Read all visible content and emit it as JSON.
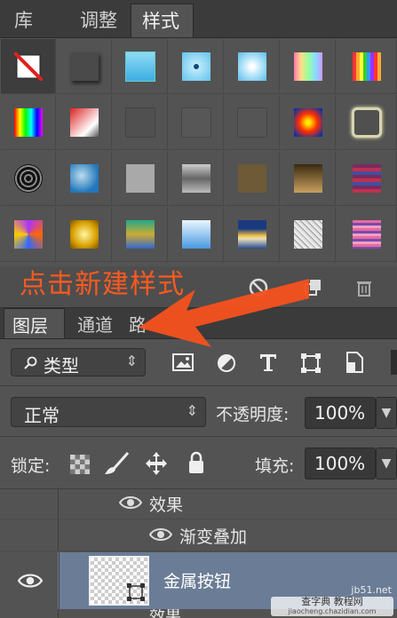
{
  "tabs": {
    "library": "库",
    "adjust": "调整",
    "styles": "样式"
  },
  "annotation": "点击新建样式",
  "layers_tabs": {
    "layers": "图层",
    "channels": "通道",
    "paths": "路"
  },
  "filter": {
    "kind_label": "类型",
    "arrows": "⇕"
  },
  "blend": {
    "mode": "正常",
    "opacity_label": "不透明度:",
    "opacity": "100%"
  },
  "lock": {
    "label": "锁定:",
    "fill_label": "填充:",
    "fill": "100%"
  },
  "layers": {
    "effects_label": "效果",
    "gradient_overlay": "渐变叠加",
    "layer_name": "金属按钮",
    "next_effects": "效果"
  },
  "watermark": {
    "line1": "查字典 教程网",
    "line2": "jiaocheng.chazidian.com",
    "site": "jb51.net"
  },
  "swatches": [
    [
      "none",
      "dark-gray",
      "cyan-blue",
      "blue-dot",
      "blue-glow",
      "pastel-rainbow",
      "rainbow-stripes"
    ],
    [
      "spectrum",
      "red-fade",
      "gray-square",
      "gray-square-2",
      "gray-square-3",
      "red-orb",
      "framed-button"
    ],
    [
      "chrome-rings",
      "blue-cloud",
      "light-gray",
      "metal-texture",
      "olive-brown",
      "bronze-gradient",
      "purple-stripes"
    ],
    [
      "psychedelic",
      "gold",
      "multicolor-band",
      "sky-blue",
      "sunset-horizon",
      "noise-silver",
      "pink-stripes"
    ]
  ],
  "colors": {
    "accent": "#ff5a1f",
    "panel_bg": "#535353",
    "tab_bg": "#3b3b3b",
    "selected_layer": "#6b7d96"
  }
}
